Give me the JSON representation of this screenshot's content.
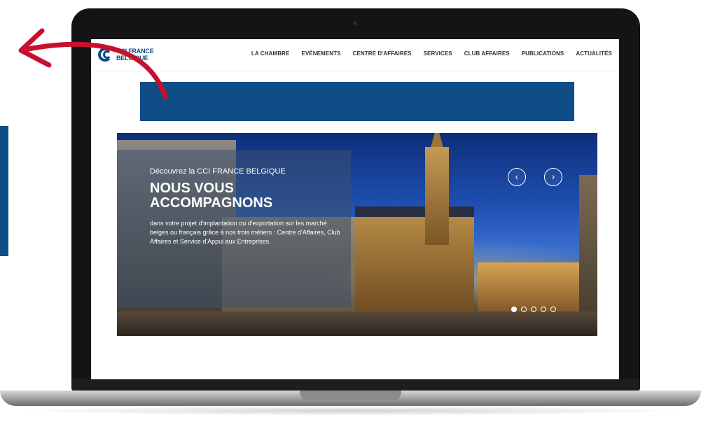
{
  "header": {
    "logo_line1": "CCI FRANCE",
    "logo_line2": "BELGIQUE",
    "nav": [
      {
        "label": "LA CHAMBRE"
      },
      {
        "label": "EVÉNEMENTS"
      },
      {
        "label": "CENTRE D'AFFAIRES"
      },
      {
        "label": "SERVICES"
      },
      {
        "label": "CLUB AFFAIRES"
      },
      {
        "label": "PUBLICATIONS"
      },
      {
        "label": "ACTUALITÉS"
      }
    ]
  },
  "hero": {
    "kicker": "Découvrez la CCI FRANCE BELGIQUE",
    "headline_line1": "NOUS VOUS",
    "headline_line2": "ACCOMPAGNONS",
    "body": "dans votre projet d'implantation ou d'exportation sur les marché belges ou français grâce à nos trois métiers : Centre d'Affaires, Club Affaires et Service d'Appui aux Entreprises.",
    "prev_icon": "‹",
    "next_icon": "›",
    "slide_count": 5,
    "active_slide": 1
  },
  "colors": {
    "brand_blue": "#0f4d86",
    "annotation_red": "#c8102e"
  },
  "icons": {
    "prev": "chevron-left-icon",
    "next": "chevron-right-icon",
    "annotation": "curved-arrow-icon"
  }
}
